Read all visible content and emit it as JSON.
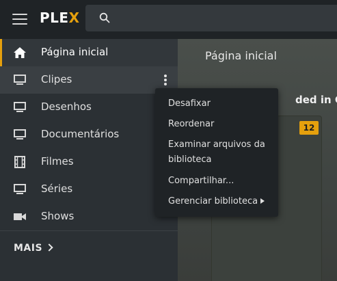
{
  "app": {
    "logo_main": "PLE",
    "logo_accent": "X"
  },
  "sidebar": {
    "items": [
      {
        "label": "Página inicial",
        "icon": "home-icon"
      },
      {
        "label": "Clipes",
        "icon": "monitor-icon"
      },
      {
        "label": "Desenhos",
        "icon": "monitor-icon"
      },
      {
        "label": "Documentários",
        "icon": "monitor-icon"
      },
      {
        "label": "Filmes",
        "icon": "film-icon"
      },
      {
        "label": "Séries",
        "icon": "monitor-icon"
      },
      {
        "label": "Shows",
        "icon": "video-camera-icon"
      }
    ],
    "more_label": "MAIS"
  },
  "main": {
    "page_title": "Página inicial",
    "section_title": "ded in Clipes",
    "badge_count": "12"
  },
  "menu": {
    "items": [
      {
        "label": "Desafixar"
      },
      {
        "label": "Reordenar"
      },
      {
        "label": "Examinar arquivos da biblioteca"
      },
      {
        "label": "Compartilhar..."
      },
      {
        "label": "Gerenciar biblioteca"
      }
    ]
  },
  "colors": {
    "accent": "#e5a00d",
    "sidebar_bg": "#2b3034",
    "topbar_bg": "#1f2326",
    "menu_bg": "#1f2326"
  }
}
